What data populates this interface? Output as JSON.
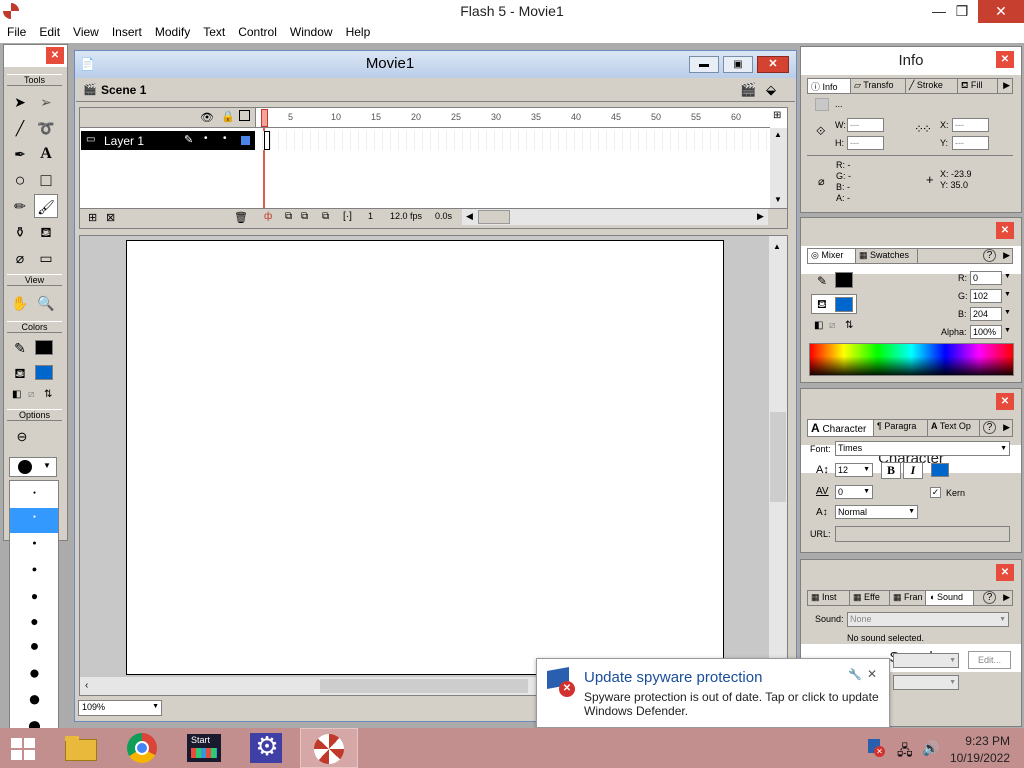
{
  "window": {
    "title": "Flash 5 - Movie1",
    "min": "—",
    "max": "❒",
    "close": "✕"
  },
  "menu": [
    "File",
    "Edit",
    "View",
    "Insert",
    "Modify",
    "Text",
    "Control",
    "Window",
    "Help"
  ],
  "tools": {
    "header": "Tools",
    "view_header": "View",
    "colors_header": "Colors",
    "options_header": "Options",
    "items": [
      "arrow",
      "subselect",
      "line",
      "lasso",
      "pen",
      "text",
      "oval",
      "rectangle",
      "pencil",
      "brush",
      "ink-bottle",
      "paint-bucket",
      "dropper",
      "eraser"
    ]
  },
  "movie": {
    "title": "Movie1",
    "scene": "Scene 1",
    "layer": "Layer 1",
    "frames": [
      "5",
      "10",
      "15",
      "20",
      "25",
      "30",
      "35",
      "40",
      "45",
      "50",
      "55",
      "60"
    ],
    "current_frame": "1",
    "fps": "12.0 fps",
    "time": "0.0s",
    "zoom": "109%"
  },
  "info_panel": {
    "title": "Info",
    "tabs": [
      "Info",
      "Transfo",
      "Stroke",
      "Fill"
    ],
    "dots": "...",
    "w_label": "W:",
    "w_value": "---",
    "h_label": "H:",
    "h_value": "---",
    "x_label": "X:",
    "x_value": "---",
    "y_label": "Y:",
    "y_value": "---",
    "r_label": "R: -",
    "g_label": "G: -",
    "b_label": "B: -",
    "a_label": "A: -",
    "cursor_x": "X:  -23.9",
    "cursor_y": "Y:  35.0"
  },
  "mixer_panel": {
    "title": "Mixer",
    "tabs": [
      "Mixer",
      "Swatches"
    ],
    "help": "?",
    "r_label": "R:",
    "r_value": "0",
    "g_label": "G:",
    "g_value": "102",
    "b_label": "B:",
    "b_value": "204",
    "alpha_label": "Alpha:",
    "alpha_value": "100%",
    "stroke_color": "#000000",
    "fill_color": "#0066cc"
  },
  "character_panel": {
    "title": "Character",
    "tabs": [
      "Character",
      "Paragra",
      "Text Op"
    ],
    "help": "?",
    "font_label": "Font:",
    "font_value": "Times",
    "size_value": "12",
    "bold": "B",
    "italic": "I",
    "kern_value": "0",
    "kern_label": "Kern",
    "baseline_value": "Normal",
    "url_label": "URL:",
    "text_color": "#0066cc"
  },
  "sound_panel": {
    "title": "Sound",
    "tabs": [
      "Inst",
      "Effe",
      "Fran",
      "Sound"
    ],
    "help": "?",
    "sound_label": "Sound:",
    "sound_value": "None",
    "status": "No sound selected.",
    "edit_label": "Edit..."
  },
  "notification": {
    "title": "Update spyware protection",
    "body": "Spyware protection is out of date. Tap or click to update Windows Defender."
  },
  "taskbar": {
    "start_tile_label": "Start",
    "time": "9:23 PM",
    "date": "10/19/2022"
  }
}
